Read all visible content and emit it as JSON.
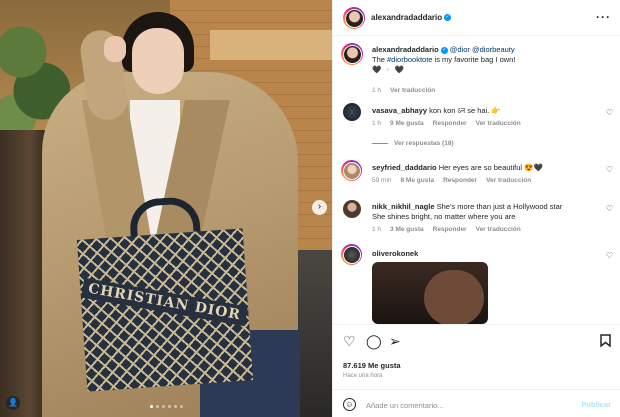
{
  "post": {
    "username": "alexandradaddario",
    "caption_mentions": "@dior @diorbeauty",
    "caption_pre": "The ",
    "caption_tag": "#diorbooktote",
    "caption_post": " is my favorite bag I own!",
    "caption_line2": "🖤 ▫️ 🖤",
    "caption_time": "1 h",
    "caption_translate": "Ver traducción",
    "bag_text": "CHRISTIAN DIOR",
    "image_count": 6,
    "image_active": 0
  },
  "comments": [
    {
      "user": "vasava_abhayy",
      "text": "kon kon ऽन se hai. 👉",
      "time": "1 h",
      "likes": "9 Me gusta",
      "reply": "Responder",
      "translate": "Ver traducción",
      "replies": "Ver respuestas (18)"
    },
    {
      "user": "seyfried_daddario",
      "text": "Her eyes are so beautiful 😍🖤",
      "time": "59 min",
      "likes": "8 Me gusta",
      "reply": "Responder",
      "translate": "Ver traducción"
    },
    {
      "user": "nikk_nikhil_nagle",
      "text": "She's more than just a Hollywood star She shines bright, no matter where you are",
      "time": "1 h",
      "likes": "3 Me gusta",
      "reply": "Responder",
      "translate": "Ver traducción"
    },
    {
      "user": "oliverokonek",
      "text": ""
    }
  ],
  "footer": {
    "likes": "87.619 Me gusta",
    "time": "Hace una hora",
    "comment_placeholder": "Añade un comentario...",
    "post_label": "Publicar"
  }
}
